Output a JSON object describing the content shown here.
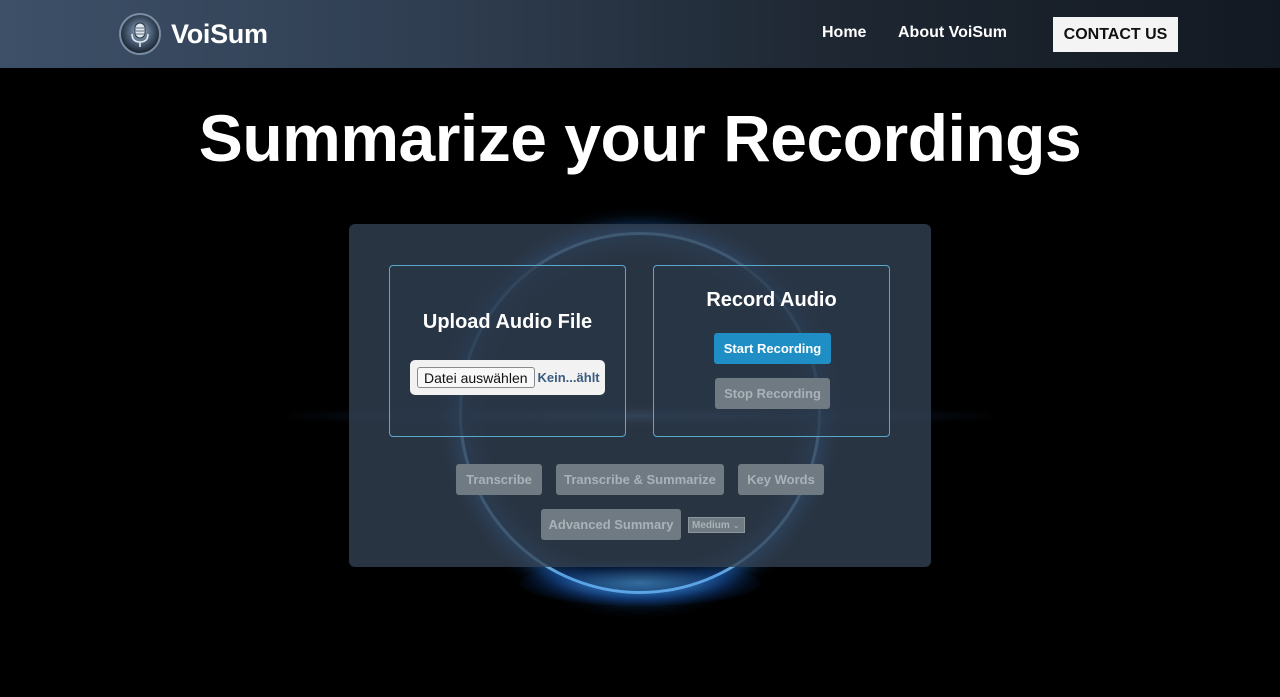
{
  "nav": {
    "brand": "VoiSum",
    "logo_icon": "microphone-icon",
    "links": [
      "Home",
      "About VoiSum"
    ],
    "contact": "CONTACT US"
  },
  "hero": {
    "title": "Summarize your Recordings"
  },
  "upload": {
    "title": "Upload Audio File",
    "file_button": "Datei auswählen",
    "file_status": "Kein...ählt"
  },
  "record": {
    "title": "Record Audio",
    "start": "Start Recording",
    "stop": "Stop Recording"
  },
  "actions": {
    "transcribe": "Transcribe",
    "transcribe_summarize": "Transcribe & Summarize",
    "key_words": "Key Words",
    "advanced_summary": "Advanced Summary",
    "summary_length": "Medium"
  },
  "colors": {
    "accent": "#1f8ec4",
    "disabled": "#6f7a82",
    "card_border": "#5aa9cc"
  }
}
